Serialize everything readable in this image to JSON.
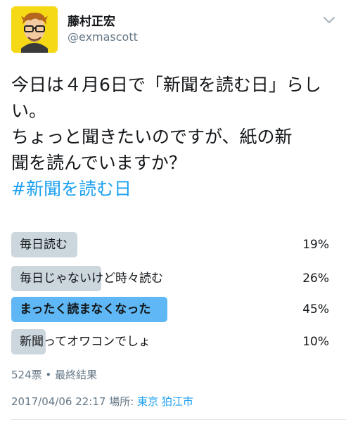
{
  "author": {
    "name": "藤村正宏",
    "handle": "@exmascott",
    "avatar_bg": "#f5d816"
  },
  "tweet": {
    "lines": [
      "今日は４月6日で「新聞を読む日」らし",
      "い。",
      "ちょっと聞きたいのですが、紙の新",
      "聞を読んでいますか？"
    ],
    "hashtag": "#新聞を読む日"
  },
  "poll": {
    "options": [
      {
        "label": "毎日読む",
        "percent_text": "19%",
        "percent": 19,
        "winner": false
      },
      {
        "label": "毎日じゃないけど時々読む",
        "percent_text": "26%",
        "percent": 26,
        "winner": false
      },
      {
        "label": "まったく読まなくなった",
        "percent_text": "45%",
        "percent": 45,
        "winner": true
      },
      {
        "label": "新聞ってオワコンでしょ",
        "percent_text": "10%",
        "percent": 10,
        "winner": false
      }
    ],
    "votes": "524票",
    "separator": "•",
    "status": "最終結果"
  },
  "meta": {
    "datetime": "2017/04/06 22:17",
    "place_label": "場所:",
    "location": "東京 狛江市"
  },
  "colors": {
    "accent": "#1da1f2",
    "bar": "#ccd6dd",
    "winner_bar": "#5fb8f5",
    "muted": "#657786"
  },
  "icons": {
    "menu": "chevron-down-icon"
  }
}
